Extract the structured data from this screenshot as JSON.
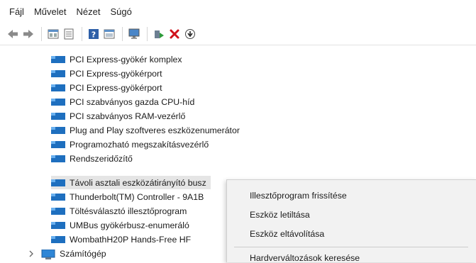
{
  "menu": [
    "Fájl",
    "Művelet",
    "Nézet",
    "Súgó"
  ],
  "toolbar_icons": [
    "back-icon",
    "forward-icon",
    "properties-icon",
    "view-icon",
    "help-icon",
    "window-icon",
    "monitor-icon",
    "add-driver-icon",
    "delete-icon",
    "download-icon"
  ],
  "tree": {
    "items": [
      "PCI Express-gyökér komplex",
      "PCI Express-gyökérport",
      "PCI Express-gyökérport",
      "PCI szabványos gazda CPU-híd",
      "PCI szabványos RAM-vezérlő",
      "Plug and Play szoftveres eszközenumerátor",
      "Programozható megszakításvezérlő",
      "Rendszeridőzítő",
      "Távoli asztali eszközátirányító busz",
      "Thunderbolt(TM) Controller - 9A1B",
      "Töltésválasztó illesztőprogram",
      "UMBus gyökérbusz-enumeráló",
      "WombathH20P Hands-Free HF"
    ],
    "selected_index": 8,
    "parent": "Számítógép"
  },
  "context_menu": {
    "items": [
      "Illesztőprogram frissítése",
      "Eszköz letiltása",
      "Eszköz eltávolítása",
      "Hardverváltozások keresése"
    ]
  },
  "colors": {
    "device_icon": "#1e6fbf",
    "selected_bg": "#e5e5e5",
    "delete": "#d0121b",
    "add": "#2e9a3a"
  }
}
